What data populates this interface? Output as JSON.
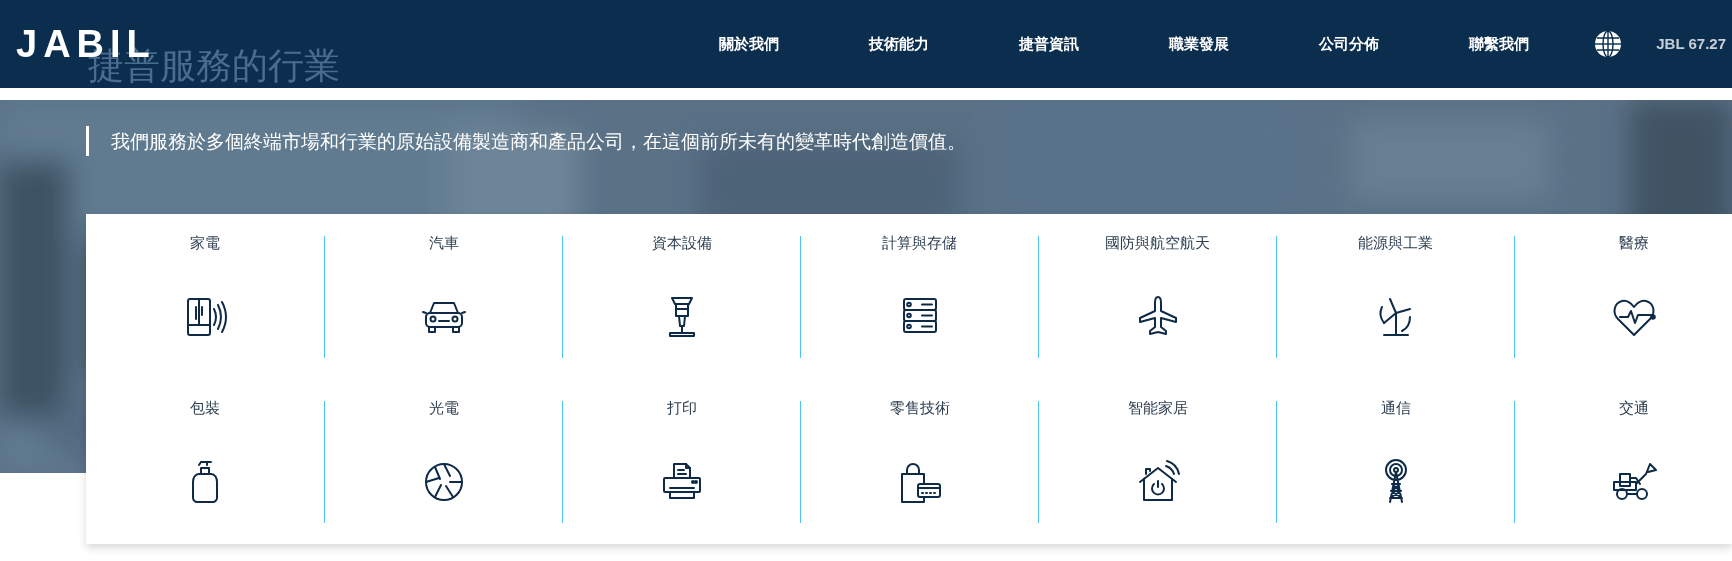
{
  "header": {
    "logo": "JABIL",
    "nav": [
      "關於我們",
      "技術能力",
      "捷普資訊",
      "職業發展",
      "公司分佈",
      "聯繫我們"
    ],
    "stock": "JBL 67.27"
  },
  "page_title": "捷普服務的行業",
  "hero": {
    "tagline": "我們服務於多個終端市場和行業的原始設備製造商和產品公司，在這個前所未有的變革時代創造價值。"
  },
  "industries": [
    {
      "label": "家電"
    },
    {
      "label": "汽車"
    },
    {
      "label": "資本設備"
    },
    {
      "label": "計算與存儲"
    },
    {
      "label": "國防與航空航天"
    },
    {
      "label": "能源與工業"
    },
    {
      "label": "醫療"
    },
    {
      "label": "包裝"
    },
    {
      "label": "光電"
    },
    {
      "label": "打印"
    },
    {
      "label": "零售技術"
    },
    {
      "label": "智能家居"
    },
    {
      "label": "通信"
    },
    {
      "label": "交通"
    }
  ]
}
